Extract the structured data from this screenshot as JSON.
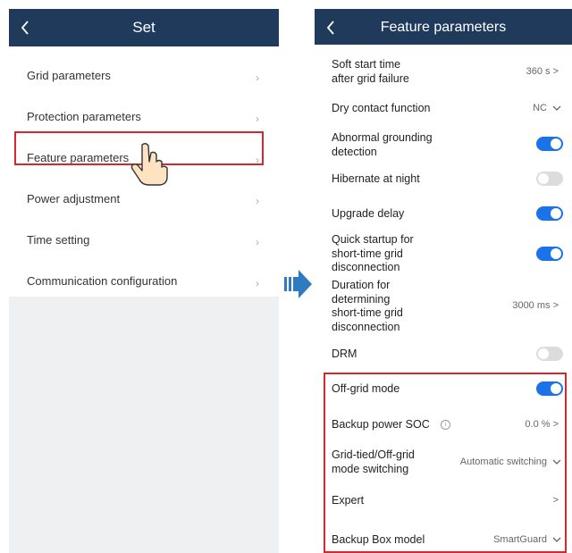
{
  "left": {
    "header": {
      "title": "Set"
    },
    "items": [
      {
        "label": "Grid parameters"
      },
      {
        "label": "Protection parameters"
      },
      {
        "label": "Feature parameters"
      },
      {
        "label": "Power adjustment"
      },
      {
        "label": "Time setting"
      },
      {
        "label": "Communication configuration"
      }
    ]
  },
  "right": {
    "header": {
      "title": "Feature parameters"
    },
    "rows": [
      {
        "label": "Soft start time\nafter grid failure",
        "value": "360 s >"
      },
      {
        "label": "Dry contact function",
        "value": "NC"
      },
      {
        "label": "Abnormal grounding\ndetection",
        "toggle": "on"
      },
      {
        "label": "Hibernate at night",
        "toggle": "off"
      },
      {
        "label": "Upgrade delay",
        "toggle": "on"
      },
      {
        "label": "Quick startup for\nshort-time grid\ndisconnection",
        "toggle": "on"
      },
      {
        "label": "Duration for\ndetermining\nshort-time grid\ndisconnection",
        "value": "3000 ms >"
      },
      {
        "label": "DRM",
        "toggle": "off"
      },
      {
        "label": "Off-grid mode",
        "toggle": "on"
      },
      {
        "label": "Backup power SOC",
        "value": "0.0 % >"
      },
      {
        "label": "Grid-tied/Off-grid\nmode switching",
        "value": "Automatic switching"
      },
      {
        "label": "Expert",
        "value": ">"
      },
      {
        "label": "Backup Box model",
        "value": "SmartGuard"
      }
    ]
  },
  "colors": {
    "header": "#1f3a5a",
    "toggle_on": "#1a73e8",
    "highlight": "#d7262c"
  }
}
